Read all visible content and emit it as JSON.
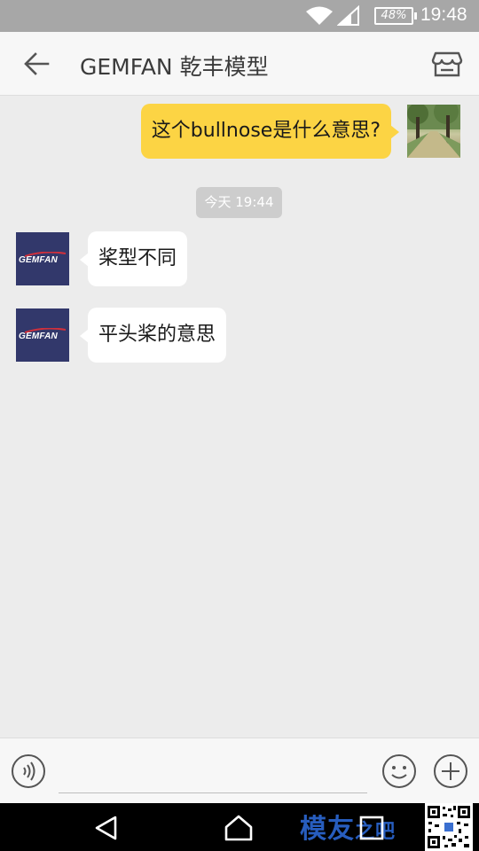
{
  "status_bar": {
    "battery": "48%",
    "time": "19:48",
    "icons": [
      "wifi-icon",
      "signal-icon",
      "battery-icon"
    ]
  },
  "header": {
    "title": "GEMFAN 乾丰模型",
    "back_icon": "arrow-left-icon",
    "store_icon": "store-icon"
  },
  "messages": [
    {
      "direction": "outgoing",
      "text": "这个bullnose是什么意思?"
    },
    {
      "type": "timestamp",
      "text": "今天 19:44"
    },
    {
      "direction": "incoming",
      "text": "桨型不同",
      "avatar_text": "GEMFAN"
    },
    {
      "direction": "incoming",
      "text": "平头桨的意思",
      "avatar_text": "GEMFAN"
    }
  ],
  "input": {
    "value": "",
    "placeholder": "",
    "voice_icon": "voice-icon",
    "emoji_icon": "emoji-icon",
    "plus_icon": "plus-icon"
  },
  "nav": {
    "icons": [
      "nav-back-icon",
      "nav-home-icon",
      "nav-recent-icon"
    ]
  },
  "watermark": {
    "main": "模友",
    "tail": "之吧"
  },
  "colors": {
    "outgoing_bubble": "#fcd444",
    "incoming_bubble": "#ffffff",
    "chat_bg": "#ececec",
    "status_bar": "#a7a7a7",
    "avatar_bg": "#32386b"
  }
}
